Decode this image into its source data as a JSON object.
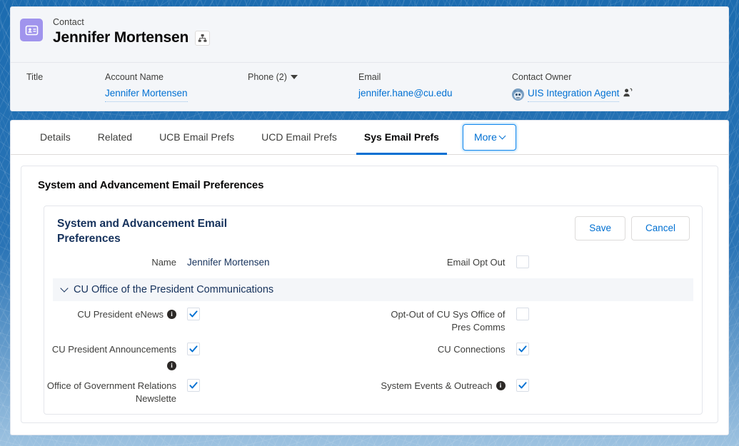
{
  "header": {
    "record_type": "Contact",
    "record_name": "Jennifer Mortensen",
    "object_icon": "contact-card-icon",
    "hierarchy_icon": "org-hierarchy-icon",
    "fields": [
      {
        "label": "Title",
        "value": "",
        "kind": "text"
      },
      {
        "label": "Account Name",
        "value": "Jennifer Mortensen",
        "kind": "link"
      },
      {
        "label": "Phone (2)",
        "value": "",
        "kind": "dropdown"
      },
      {
        "label": "Email",
        "value": "jennifer.hane@cu.edu",
        "kind": "plain-link"
      },
      {
        "label": "Contact Owner",
        "value": "UIS Integration Agent",
        "kind": "owner"
      }
    ]
  },
  "tabs": {
    "items": [
      {
        "label": "Details",
        "active": false
      },
      {
        "label": "Related",
        "active": false
      },
      {
        "label": "UCB Email Prefs",
        "active": false
      },
      {
        "label": "UCD Email Prefs",
        "active": false
      },
      {
        "label": "Sys Email Prefs",
        "active": true
      }
    ],
    "more_label": "More"
  },
  "card": {
    "outer_title": "System and Advancement Email Preferences",
    "inner_title": "System and Advancement Email Preferences",
    "save_label": "Save",
    "cancel_label": "Cancel",
    "name_label": "Name",
    "name_value": "Jennifer Mortensen",
    "opt_out_label": "Email Opt Out",
    "opt_out_checked": false,
    "section_title": "CU Office of the President Communications",
    "rows": [
      {
        "left": {
          "label": "CU President eNews",
          "info": true,
          "checked": true
        },
        "right": {
          "label": "Opt-Out of CU Sys Office of Pres Comms",
          "info": false,
          "checked": false
        }
      },
      {
        "left": {
          "label": "CU President Announcements",
          "info": true,
          "checked": true
        },
        "right": {
          "label": "CU Connections",
          "info": false,
          "checked": true
        }
      },
      {
        "left": {
          "label": "Office of Government Relations Newslette",
          "info": false,
          "checked": true
        },
        "right": {
          "label": "System Events & Outreach",
          "info": true,
          "checked": true
        }
      }
    ]
  },
  "colors": {
    "link": "#0070d2",
    "navy": "#16325c",
    "accent": "#1589ee",
    "object_icon_bg": "#a094ed",
    "section_bg": "#f4f6f9"
  }
}
